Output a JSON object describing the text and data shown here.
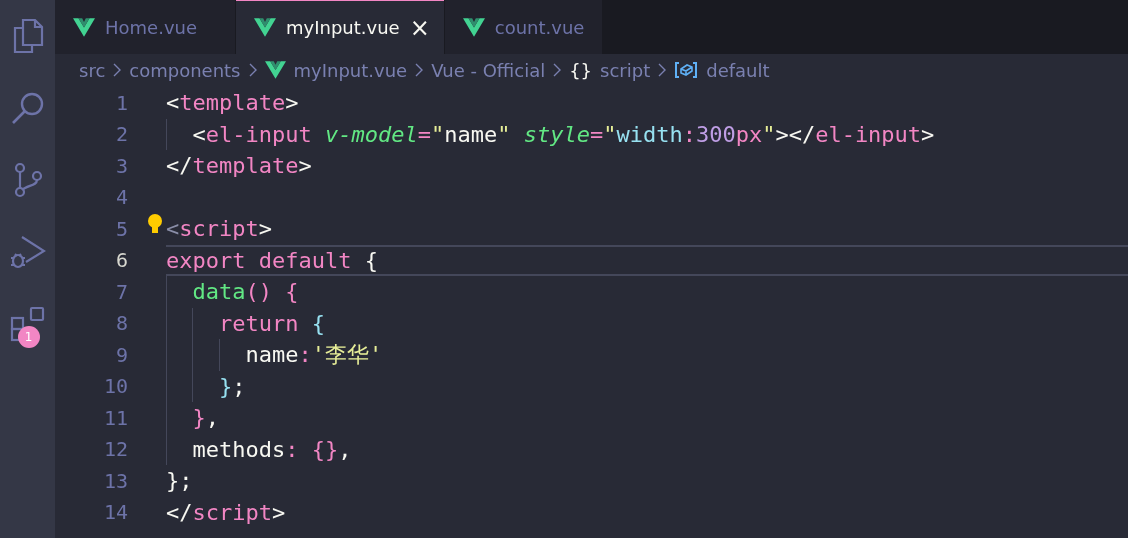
{
  "activity_bar": {
    "extensions_badge": "1"
  },
  "tabs": [
    {
      "label": "Home.vue",
      "selected": false
    },
    {
      "label": "myInput.vue",
      "selected": true,
      "close": "×"
    },
    {
      "label": "count.vue",
      "selected": false
    }
  ],
  "breadcrumbs": [
    {
      "label": "src",
      "kind": "plain"
    },
    {
      "label": "components",
      "kind": "plain"
    },
    {
      "label": "myInput.vue",
      "kind": "vue"
    },
    {
      "label": "Vue - Official",
      "kind": "plain"
    },
    {
      "label": "script",
      "kind": "braces",
      "glyph": "{}"
    },
    {
      "label": "default",
      "kind": "module"
    }
  ],
  "editor": {
    "lines": [
      {
        "number": "1",
        "current": false,
        "tokens": [
          {
            "text": "<",
            "kind": "plain"
          },
          {
            "text": "template",
            "kind": "tag"
          },
          {
            "text": ">",
            "kind": "plain"
          }
        ]
      },
      {
        "number": "2",
        "current": false,
        "tokens": [
          {
            "text": "  <",
            "kind": "plain"
          },
          {
            "text": "el-input",
            "kind": "tag"
          },
          {
            "text": " v-model",
            "kind": "attr"
          },
          {
            "text": "=",
            "kind": "tag"
          },
          {
            "text": "\"",
            "kind": "str"
          },
          {
            "text": "name",
            "kind": "plain"
          },
          {
            "text": "\"",
            "kind": "str"
          },
          {
            "text": " style",
            "kind": "attr"
          },
          {
            "text": "=",
            "kind": "tag"
          },
          {
            "text": "\"",
            "kind": "str"
          },
          {
            "text": "width",
            "kind": "prop"
          },
          {
            "text": ":",
            "kind": "tag"
          },
          {
            "text": "300",
            "kind": "num"
          },
          {
            "text": "px",
            "kind": "tag"
          },
          {
            "text": "\"",
            "kind": "str"
          },
          {
            "text": "></",
            "kind": "plain"
          },
          {
            "text": "el-input",
            "kind": "tag"
          },
          {
            "text": ">",
            "kind": "plain"
          }
        ]
      },
      {
        "number": "3",
        "current": false,
        "tokens": [
          {
            "text": "</",
            "kind": "plain"
          },
          {
            "text": "template",
            "kind": "tag"
          },
          {
            "text": ">",
            "kind": "plain"
          }
        ]
      },
      {
        "number": "4",
        "current": false
      },
      {
        "number": "5",
        "current": false,
        "lightbulb": true,
        "tokens": [
          {
            "text": "<",
            "kind": "dim"
          },
          {
            "text": "script",
            "kind": "tag"
          },
          {
            "text": ">",
            "kind": "plain"
          }
        ]
      },
      {
        "number": "6",
        "current": true,
        "tokens": [
          {
            "text": "export default ",
            "kind": "tag"
          },
          {
            "text": "{",
            "kind": "plain"
          }
        ]
      },
      {
        "number": "7",
        "current": false,
        "tokens": [
          {
            "text": "  data",
            "kind": "fn"
          },
          {
            "text": "() {",
            "kind": "tag"
          }
        ]
      },
      {
        "number": "8",
        "current": false,
        "tokens": [
          {
            "text": "    return ",
            "kind": "tag"
          },
          {
            "text": "{",
            "kind": "prop"
          }
        ]
      },
      {
        "number": "9",
        "current": false,
        "tokens": [
          {
            "text": "      name",
            "kind": "plain"
          },
          {
            "text": ":",
            "kind": "tag"
          },
          {
            "text": "'李华'",
            "kind": "str"
          }
        ]
      },
      {
        "number": "10",
        "current": false,
        "tokens": [
          {
            "text": "    }",
            "kind": "prop"
          },
          {
            "text": ";",
            "kind": "plain"
          }
        ]
      },
      {
        "number": "11",
        "current": false,
        "tokens": [
          {
            "text": "  }",
            "kind": "tag"
          },
          {
            "text": ",",
            "kind": "plain"
          }
        ]
      },
      {
        "number": "12",
        "current": false,
        "tokens": [
          {
            "text": "  methods",
            "kind": "plain"
          },
          {
            "text": ": ",
            "kind": "tag"
          },
          {
            "text": "{}",
            "kind": "tag"
          },
          {
            "text": ",",
            "kind": "plain"
          }
        ]
      },
      {
        "number": "13",
        "current": false,
        "tokens": [
          {
            "text": "};",
            "kind": "plain"
          }
        ]
      },
      {
        "number": "14",
        "current": false,
        "tokens": [
          {
            "text": "</",
            "kind": "plain"
          },
          {
            "text": "script",
            "kind": "tag"
          },
          {
            "text": ">",
            "kind": "plain"
          }
        ]
      }
    ]
  }
}
